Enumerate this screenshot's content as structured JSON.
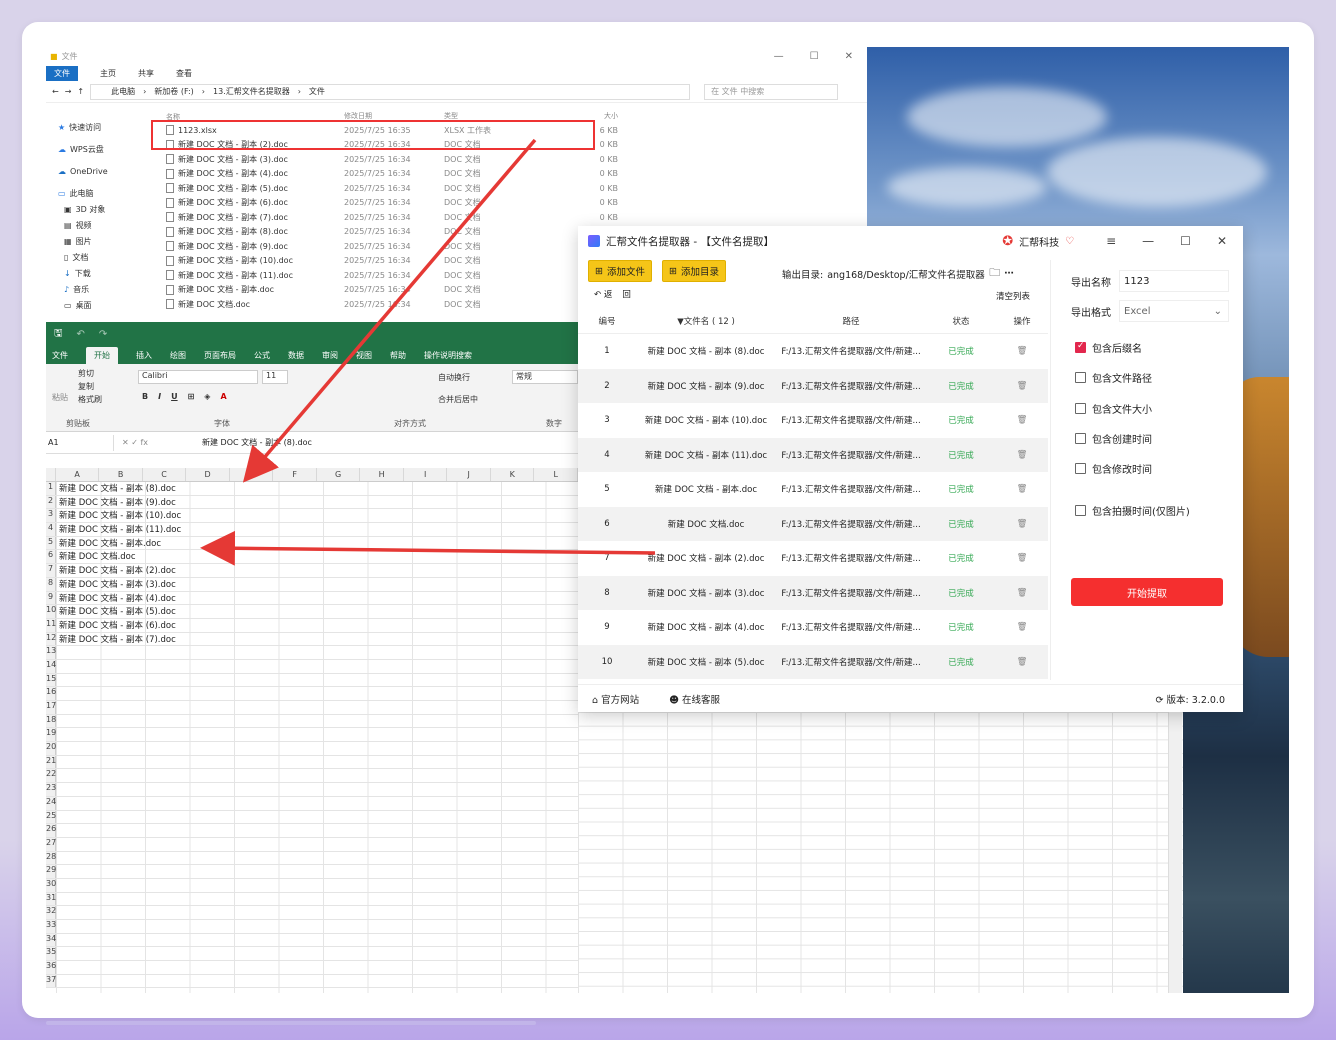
{
  "explorer": {
    "title": "文件",
    "ribbon": [
      "文件",
      "主页",
      "共享",
      "查看"
    ],
    "address": [
      "此电脑",
      "新加卷 (F:)",
      "13.汇帮文件名提取器",
      "文件"
    ],
    "search_placeholder": "在 文件 中搜索",
    "nav": [
      "快速访问",
      "WPS云盘",
      "OneDrive",
      "此电脑",
      "3D 对象",
      "视频",
      "图片",
      "文档",
      "下载",
      "音乐",
      "桌面"
    ],
    "headers": [
      "名称",
      "修改日期",
      "类型",
      "大小"
    ],
    "files": [
      {
        "name": "1123.xlsx",
        "date": "2025/7/25 16:35",
        "type": "XLSX 工作表",
        "size": "6 KB"
      },
      {
        "name": "新建 DOC 文档 - 副本 (2).doc",
        "date": "2025/7/25 16:34",
        "type": "DOC 文档",
        "size": "0 KB"
      },
      {
        "name": "新建 DOC 文档 - 副本 (3).doc",
        "date": "2025/7/25 16:34",
        "type": "DOC 文档",
        "size": "0 KB"
      },
      {
        "name": "新建 DOC 文档 - 副本 (4).doc",
        "date": "2025/7/25 16:34",
        "type": "DOC 文档",
        "size": "0 KB"
      },
      {
        "name": "新建 DOC 文档 - 副本 (5).doc",
        "date": "2025/7/25 16:34",
        "type": "DOC 文档",
        "size": "0 KB"
      },
      {
        "name": "新建 DOC 文档 - 副本 (6).doc",
        "date": "2025/7/25 16:34",
        "type": "DOC 文档",
        "size": "0 KB"
      },
      {
        "name": "新建 DOC 文档 - 副本 (7).doc",
        "date": "2025/7/25 16:34",
        "type": "DOC 文档",
        "size": "0 KB"
      },
      {
        "name": "新建 DOC 文档 - 副本 (8).doc",
        "date": "2025/7/25 16:34",
        "type": "DOC 文档",
        "size": "0 KB"
      },
      {
        "name": "新建 DOC 文档 - 副本 (9).doc",
        "date": "2025/7/25 16:34",
        "type": "DOC 文档",
        "size": "0 KB"
      },
      {
        "name": "新建 DOC 文档 - 副本 (10).doc",
        "date": "2025/7/25 16:34",
        "type": "DOC 文档",
        "size": "0 KB"
      },
      {
        "name": "新建 DOC 文档 - 副本 (11).doc",
        "date": "2025/7/25 16:34",
        "type": "DOC 文档",
        "size": "0 KB"
      },
      {
        "name": "新建 DOC 文档 - 副本.doc",
        "date": "2025/7/25 16:34",
        "type": "DOC 文档",
        "size": "0 KB"
      },
      {
        "name": "新建 DOC 文档.doc",
        "date": "2025/7/25 16:34",
        "type": "DOC 文档",
        "size": "0 KB"
      }
    ]
  },
  "excel": {
    "tabs": [
      "文件",
      "开始",
      "插入",
      "绘图",
      "页面布局",
      "公式",
      "数据",
      "审阅",
      "视图",
      "帮助",
      "操作说明搜索"
    ],
    "clipboard": [
      "剪切",
      "复制",
      "格式刷",
      "粘贴",
      "剪贴板"
    ],
    "font_name": "Calibri",
    "font_size": "11",
    "groups": [
      "字体",
      "对齐方式",
      "数字"
    ],
    "wrap": "自动换行",
    "merge": "合并后居中",
    "numfmt": "常规",
    "cell_ref": "A1",
    "formula": "新建 DOC 文档 - 副本 (8).doc",
    "columns": [
      "A",
      "B",
      "C",
      "D",
      "E",
      "F",
      "G",
      "H",
      "I",
      "J",
      "K",
      "L"
    ],
    "rows": [
      "新建 DOC 文档 - 副本 (8).doc",
      "新建 DOC 文档 - 副本 (9).doc",
      "新建 DOC 文档 - 副本 (10).doc",
      "新建 DOC 文档 - 副本 (11).doc",
      "新建 DOC 文档 - 副本.doc",
      "新建 DOC 文档.doc",
      "新建 DOC 文档 - 副本 (2).doc",
      "新建 DOC 文档 - 副本 (3).doc",
      "新建 DOC 文档 - 副本 (4).doc",
      "新建 DOC 文档 - 副本 (5).doc",
      "新建 DOC 文档 - 副本 (6).doc",
      "新建 DOC 文档 - 副本 (7).doc",
      "",
      "",
      "",
      "",
      "",
      "",
      "",
      "",
      "",
      "",
      "",
      "",
      "",
      "",
      "",
      "",
      "",
      "",
      "",
      "",
      "",
      "",
      "",
      "",
      ""
    ]
  },
  "app": {
    "title": "汇帮文件名提取器 - 【文件名提取】",
    "brand": "汇帮科技",
    "add_file": "添加文件",
    "add_dir": "添加目录",
    "output_label": "输出目录:",
    "output_value": "ang168/Desktop/汇帮文件名提取器",
    "back": "返",
    "home": "回",
    "clear": "清空列表",
    "headers": [
      "编号",
      "▼文件名 ( 12 )",
      "路径",
      "状态",
      "操作"
    ],
    "rows": [
      {
        "no": "1",
        "name": "新建 DOC 文档 - 副本 (8).doc",
        "path": "F:/13.汇帮文件名提取器/文件/新建...",
        "status": "已完成"
      },
      {
        "no": "2",
        "name": "新建 DOC 文档 - 副本 (9).doc",
        "path": "F:/13.汇帮文件名提取器/文件/新建...",
        "status": "已完成"
      },
      {
        "no": "3",
        "name": "新建 DOC 文档 - 副本 (10).doc",
        "path": "F:/13.汇帮文件名提取器/文件/新建...",
        "status": "已完成"
      },
      {
        "no": "4",
        "name": "新建 DOC 文档 - 副本 (11).doc",
        "path": "F:/13.汇帮文件名提取器/文件/新建...",
        "status": "已完成"
      },
      {
        "no": "5",
        "name": "新建 DOC 文档 - 副本.doc",
        "path": "F:/13.汇帮文件名提取器/文件/新建...",
        "status": "已完成"
      },
      {
        "no": "6",
        "name": "新建 DOC 文档.doc",
        "path": "F:/13.汇帮文件名提取器/文件/新建...",
        "status": "已完成"
      },
      {
        "no": "7",
        "name": "新建 DOC 文档 - 副本 (2).doc",
        "path": "F:/13.汇帮文件名提取器/文件/新建...",
        "status": "已完成"
      },
      {
        "no": "8",
        "name": "新建 DOC 文档 - 副本 (3).doc",
        "path": "F:/13.汇帮文件名提取器/文件/新建...",
        "status": "已完成"
      },
      {
        "no": "9",
        "name": "新建 DOC 文档 - 副本 (4).doc",
        "path": "F:/13.汇帮文件名提取器/文件/新建...",
        "status": "已完成"
      },
      {
        "no": "10",
        "name": "新建 DOC 文档 - 副本 (5).doc",
        "path": "F:/13.汇帮文件名提取器/文件/新建...",
        "status": "已完成"
      }
    ],
    "export_name_label": "导出名称",
    "export_name_value": "1123",
    "export_format_label": "导出格式",
    "export_format_value": "Excel",
    "options": [
      {
        "label": "包含后缀名",
        "checked": true
      },
      {
        "label": "包含文件路径",
        "checked": false
      },
      {
        "label": "包含文件大小",
        "checked": false
      },
      {
        "label": "包含创建时间",
        "checked": false
      },
      {
        "label": "包含修改时间",
        "checked": false
      },
      {
        "label": "包含拍摄时间(仅图片)",
        "checked": false
      }
    ],
    "start": "开始提取",
    "footer": {
      "site": "官方网站",
      "service": "在线客服",
      "version": "版本: 3.2.0.0"
    }
  },
  "colors": {
    "accent": "#f52f2f",
    "excel_green": "#217346",
    "done": "#34a853",
    "arrow": "#e53935"
  }
}
